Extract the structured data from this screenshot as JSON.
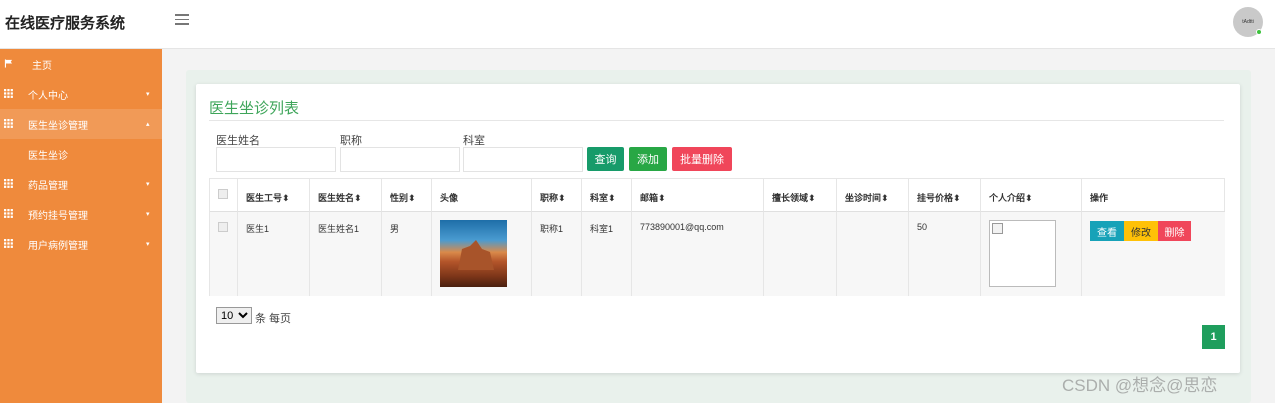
{
  "header": {
    "brand": "在线医疗服务系统",
    "avatar_text": "tAdtti"
  },
  "sidebar": {
    "items": [
      {
        "label": "主页",
        "icon": "flag-icon",
        "caret": ""
      },
      {
        "label": "个人中心",
        "icon": "grid-icon",
        "caret": "▾"
      },
      {
        "label": "医生坐诊管理",
        "icon": "grid-icon",
        "caret": "▴"
      },
      {
        "label": "医生坐诊",
        "icon": "",
        "caret": ""
      },
      {
        "label": "药品管理",
        "icon": "grid-icon",
        "caret": "▾"
      },
      {
        "label": "预约挂号管理",
        "icon": "grid-icon",
        "caret": "▾"
      },
      {
        "label": "用户病例管理",
        "icon": "grid-icon",
        "caret": "▾"
      }
    ]
  },
  "main": {
    "title": "医生坐诊列表",
    "search": {
      "doctor_name_label": "医生姓名",
      "title_label": "职称",
      "department_label": "科室"
    },
    "buttons": {
      "query": "查询",
      "add": "添加",
      "batch_delete": "批量删除"
    },
    "table": {
      "headers": [
        "医生工号",
        "医生姓名",
        "性别",
        "头像",
        "职称",
        "科室",
        "邮箱",
        "擅长领域",
        "坐诊时间",
        "挂号价格",
        "个人介绍",
        "操作"
      ],
      "rows": [
        {
          "doctor_id": "医生1",
          "doctor_name": "医生姓名1",
          "gender": "男",
          "title": "职称1",
          "department": "科室1",
          "email": "773890001@qq.com",
          "specialty": "",
          "schedule": "",
          "price": "50"
        }
      ],
      "actions": {
        "view": "查看",
        "edit": "修改",
        "delete": "删除"
      }
    },
    "pagination": {
      "page_size": "10",
      "page_size_suffix": "条 每页",
      "current_page": "1"
    }
  },
  "watermark": "CSDN @想念@思恋",
  "colors": {
    "sidebar": "#ef8a3c",
    "title_green": "#3ea55a",
    "query_btn": "#179b6a",
    "add_btn": "#28a745",
    "delete_btn": "#f0465a",
    "view_btn": "#17a2b8",
    "edit_btn": "#ffc107"
  }
}
